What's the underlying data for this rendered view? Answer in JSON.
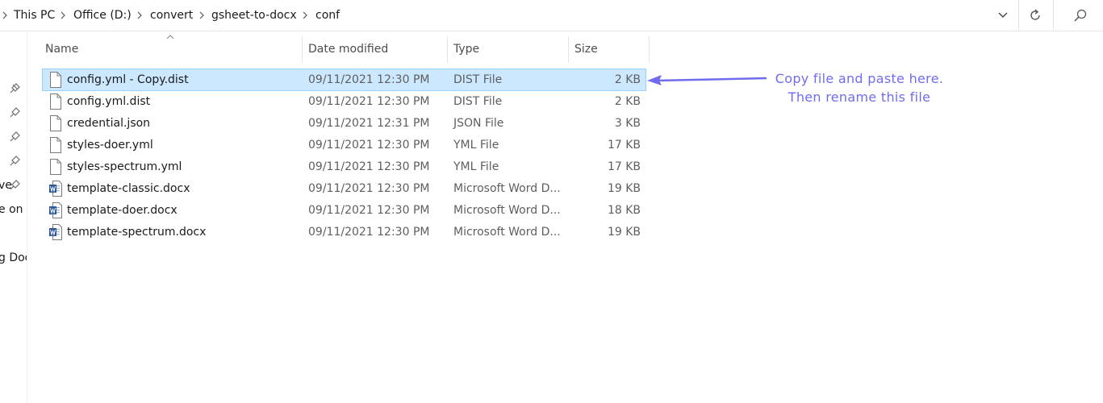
{
  "address_bar": {
    "breadcrumbs": [
      "This PC",
      "Office (D:)",
      "convert",
      "gsheet-to-docx",
      "conf"
    ],
    "icons": [
      "chevron-right-icon",
      "chevron-down-icon",
      "refresh-icon",
      "search-icon"
    ]
  },
  "nav_pane": {
    "partial_items": [
      "ve",
      "e on",
      "g Doc"
    ]
  },
  "columns": {
    "name": "Name",
    "date": "Date modified",
    "type": "Type",
    "size": "Size"
  },
  "files": [
    {
      "name": "config.yml - Copy.dist",
      "date": "09/11/2021 12:30 PM",
      "type": "DIST File",
      "size": "2 KB",
      "icon": "generic-file-icon",
      "selected": true
    },
    {
      "name": "config.yml.dist",
      "date": "09/11/2021 12:30 PM",
      "type": "DIST File",
      "size": "2 KB",
      "icon": "generic-file-icon"
    },
    {
      "name": "credential.json",
      "date": "09/11/2021 12:31 PM",
      "type": "JSON File",
      "size": "3 KB",
      "icon": "generic-file-icon"
    },
    {
      "name": "styles-doer.yml",
      "date": "09/11/2021 12:30 PM",
      "type": "YML File",
      "size": "17 KB",
      "icon": "generic-file-icon"
    },
    {
      "name": "styles-spectrum.yml",
      "date": "09/11/2021 12:30 PM",
      "type": "YML File",
      "size": "17 KB",
      "icon": "generic-file-icon"
    },
    {
      "name": "template-classic.docx",
      "date": "09/11/2021 12:30 PM",
      "type": "Microsoft Word D...",
      "size": "19 KB",
      "icon": "word-doc-icon"
    },
    {
      "name": "template-doer.docx",
      "date": "09/11/2021 12:30 PM",
      "type": "Microsoft Word D...",
      "size": "18 KB",
      "icon": "word-doc-icon"
    },
    {
      "name": "template-spectrum.docx",
      "date": "09/11/2021 12:30 PM",
      "type": "Microsoft Word D...",
      "size": "19 KB",
      "icon": "word-doc-icon"
    }
  ],
  "annotation": {
    "line1": "Copy file and paste here.",
    "line2": "Then rename this file"
  },
  "colors": {
    "selection_bg": "#cce8ff",
    "selection_border": "#99d1ff",
    "annotation": "#6f6cf0",
    "word_blue": "#2b579a"
  }
}
